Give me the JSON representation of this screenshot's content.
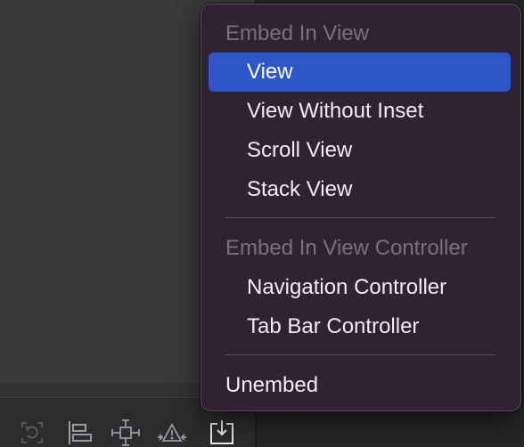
{
  "menu": {
    "sections": [
      {
        "header": "Embed In View",
        "items": [
          "View",
          "View Without Inset",
          "Scroll View",
          "Stack View"
        ],
        "selected_item": "View"
      },
      {
        "header": "Embed In View Controller",
        "items": [
          "Navigation Controller",
          "Tab Bar Controller"
        ]
      }
    ],
    "footer_item": "Unembed"
  },
  "toolbar": {
    "tools": [
      "update-frames-icon",
      "align-icon",
      "add-constraints-icon",
      "resolve-issues-icon",
      "embed-in-icon"
    ],
    "active_tool": "embed-in-icon"
  },
  "colors": {
    "menu_background": "#2f2331",
    "selection": "#2f56c6",
    "header_text": "#7a717c",
    "item_text": "#f0ecf1"
  }
}
